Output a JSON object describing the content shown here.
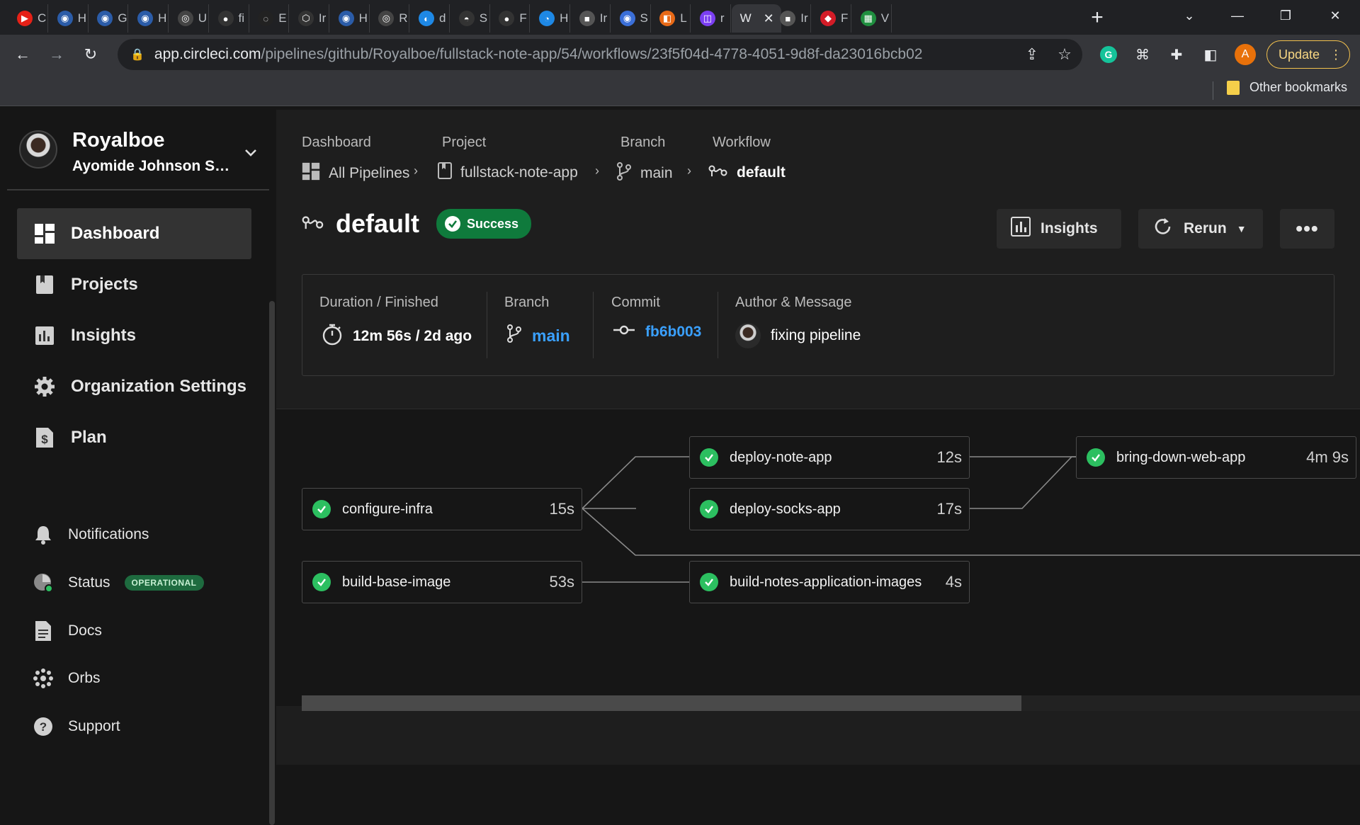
{
  "browser": {
    "tabs": [
      {
        "label": "C",
        "color": "#e62117",
        "glyph": "▶"
      },
      {
        "label": "H",
        "color": "#2b5ca8",
        "glyph": "◉"
      },
      {
        "label": "G",
        "color": "#2b5ca8",
        "glyph": "◉"
      },
      {
        "label": "H",
        "color": "#2b5ca8",
        "glyph": "◉"
      },
      {
        "label": "U",
        "color": "#444",
        "glyph": "◎"
      },
      {
        "label": "fi",
        "color": "#333",
        "glyph": "●"
      },
      {
        "label": "E",
        "color": "#222",
        "glyph": "◌"
      },
      {
        "label": "Ir",
        "color": "#333",
        "glyph": "⬡"
      },
      {
        "label": "H",
        "color": "#2b5ca8",
        "glyph": "◉"
      },
      {
        "label": "R",
        "color": "#444",
        "glyph": "◎"
      },
      {
        "label": "d",
        "color": "#1e88e5",
        "glyph": "◐"
      },
      {
        "label": "S",
        "color": "#333",
        "glyph": "◓"
      },
      {
        "label": "F",
        "color": "#333",
        "glyph": "●"
      },
      {
        "label": "H",
        "color": "#1e88e5",
        "glyph": "◔"
      },
      {
        "label": "Ir",
        "color": "#555",
        "glyph": "■"
      },
      {
        "label": "S",
        "color": "#3b6fd8",
        "glyph": "◉"
      },
      {
        "label": "L",
        "color": "#e86a17",
        "glyph": "◧"
      },
      {
        "label": "r",
        "color": "#7b3ff2",
        "glyph": "◫"
      },
      {
        "label": "W",
        "color": "#35363a",
        "glyph": ""
      },
      {
        "label": "Ir",
        "color": "#555",
        "glyph": "■"
      },
      {
        "label": "F",
        "color": "#d31c27",
        "glyph": "◆"
      },
      {
        "label": "V",
        "color": "#1f8f3f",
        "glyph": "▦"
      }
    ],
    "url_host": "app.circleci.com",
    "url_path": "/pipelines/github/Royalboe/fullstack-note-app/54/workflows/23f5f04d-4778-4051-9d8f-da23016bcb02",
    "profile_initial": "A",
    "update_label": "Update",
    "other_bookmarks": "Other bookmarks"
  },
  "sidebar": {
    "org_name": "Royalboe",
    "org_user": "Ayomide Johnson Sal...",
    "nav_main": [
      {
        "label": "Dashboard",
        "icon": "dashboard-icon"
      },
      {
        "label": "Projects",
        "icon": "projects-icon"
      },
      {
        "label": "Insights",
        "icon": "insights-icon"
      },
      {
        "label": "Organization Settings",
        "icon": "gear-icon"
      },
      {
        "label": "Plan",
        "icon": "dollar-icon"
      }
    ],
    "nav_sub": [
      {
        "label": "Notifications",
        "icon": "bell-icon"
      },
      {
        "label": "Status",
        "icon": "status-icon",
        "badge": "OPERATIONAL"
      },
      {
        "label": "Docs",
        "icon": "docs-icon"
      },
      {
        "label": "Orbs",
        "icon": "orbs-icon"
      },
      {
        "label": "Support",
        "icon": "help-icon"
      }
    ]
  },
  "breadcrumb": {
    "labels": [
      "Dashboard",
      "Project",
      "Branch",
      "Workflow"
    ],
    "items": [
      "All Pipelines",
      "fullstack-note-app",
      "main",
      "default"
    ]
  },
  "workflow": {
    "name": "default",
    "status": "Success",
    "insights_label": "Insights",
    "rerun_label": "Rerun"
  },
  "summary": {
    "duration_label": "Duration / Finished",
    "duration_value": "12m 56s / 2d ago",
    "branch_label": "Branch",
    "branch_value": "main",
    "commit_label": "Commit",
    "commit_value": "fb6b003",
    "author_label": "Author & Message",
    "message": "fixing pipeline"
  },
  "jobs": [
    {
      "name": "configure-infra",
      "duration": "15s"
    },
    {
      "name": "deploy-note-app",
      "duration": "12s"
    },
    {
      "name": "deploy-socks-app",
      "duration": "17s"
    },
    {
      "name": "bring-down-web-app",
      "duration": "4m 9s"
    },
    {
      "name": "build-base-image",
      "duration": "53s"
    },
    {
      "name": "build-notes-application-images",
      "duration": "4s"
    }
  ],
  "colors": {
    "success": "#0f7a3c",
    "job_check": "#2cbf60",
    "link": "#3aa0ff"
  }
}
